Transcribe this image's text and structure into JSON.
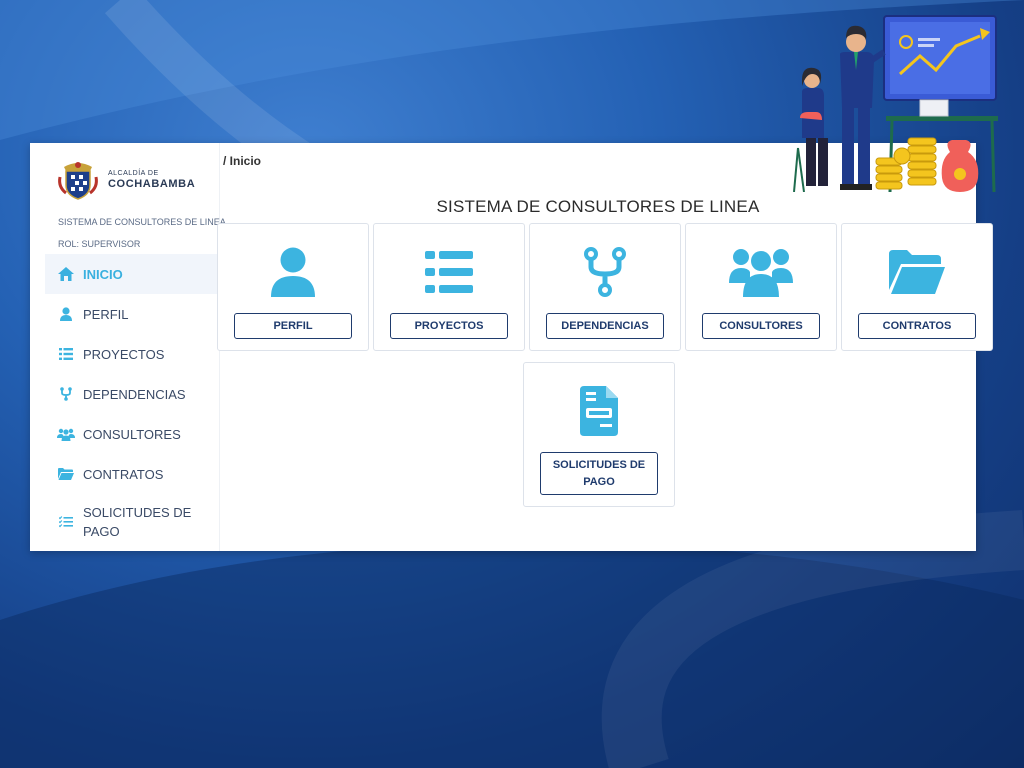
{
  "sidebar": {
    "logo": {
      "small": "ALCALDÍA DE",
      "big": "COCHABAMBA"
    },
    "system_name": "SISTEMA DE CONSULTORES DE LINEA",
    "role": "ROL: SUPERVISOR",
    "items": [
      {
        "label": "INICIO",
        "icon": "home-icon",
        "active": true
      },
      {
        "label": "PERFIL",
        "icon": "user-icon"
      },
      {
        "label": "PROYECTOS",
        "icon": "list-icon"
      },
      {
        "label": "DEPENDENCIAS",
        "icon": "branch-icon"
      },
      {
        "label": "CONSULTORES",
        "icon": "users-icon"
      },
      {
        "label": "CONTRATOS",
        "icon": "folder-icon"
      },
      {
        "label": "SOLICITUDES DE PAGO",
        "icon": "checklist-icon"
      }
    ]
  },
  "breadcrumb": "/ Inicio",
  "main": {
    "title": "SISTEMA DE CONSULTORES DE LINEA",
    "cards": [
      {
        "label": "PERFIL",
        "icon": "user-icon"
      },
      {
        "label": "PROYECTOS",
        "icon": "list-icon"
      },
      {
        "label": "DEPENDENCIAS",
        "icon": "branch-icon"
      },
      {
        "label": "CONSULTORES",
        "icon": "users-icon"
      },
      {
        "label": "CONTRATOS",
        "icon": "folder-icon"
      },
      {
        "label": "SOLICITUDES DE PAGO",
        "icon": "document-icon"
      }
    ]
  },
  "colors": {
    "accent": "#3cb4e0",
    "navy": "#1f3b6d",
    "background": "#2461b4"
  }
}
